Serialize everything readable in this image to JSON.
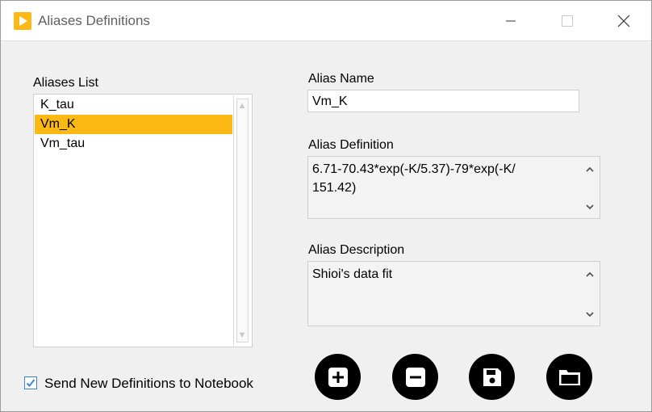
{
  "window": {
    "title": "Aliases Definitions",
    "app_icon": "play-triangle-icon",
    "accent_color": "#fcb913"
  },
  "aliases_list": {
    "label": "Aliases List",
    "items": [
      "K_tau",
      "Vm_K",
      "Vm_tau"
    ],
    "selected": "Vm_K"
  },
  "alias_name": {
    "label": "Alias Name",
    "value": "Vm_K"
  },
  "alias_definition": {
    "label": "Alias Definition",
    "value": "6.71-70.43*exp(-K/5.37)-79*exp(-K/\n151.42)"
  },
  "alias_description": {
    "label": "Alias Description",
    "value": "Shioi's data fit"
  },
  "send_checkbox": {
    "label": "Send New Definitions to Notebook",
    "checked": true
  },
  "actions": [
    {
      "name": "add",
      "icon": "plus-square-icon"
    },
    {
      "name": "remove",
      "icon": "minus-square-icon"
    },
    {
      "name": "save",
      "icon": "floppy-disk-icon"
    },
    {
      "name": "open",
      "icon": "folder-icon"
    }
  ]
}
